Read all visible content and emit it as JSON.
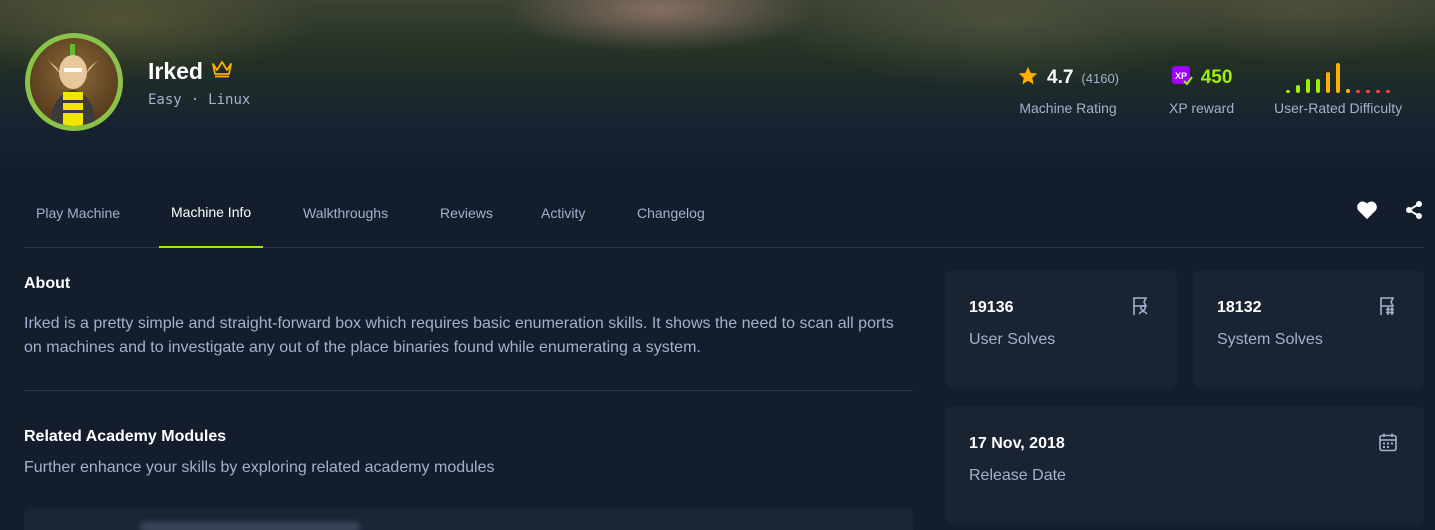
{
  "machine": {
    "name": "Irked",
    "difficulty": "Easy",
    "separator": "·",
    "os": "Linux",
    "avatar_icon": "mohawk-character-avatar",
    "tier_icon": "crown-icon"
  },
  "stats": {
    "rating": {
      "value": "4.7",
      "count": "(4160)",
      "label": "Machine Rating",
      "icon": "star-icon"
    },
    "xp": {
      "value": "450",
      "label": "XP reward",
      "icon": "xp-badge-icon"
    },
    "difficulty": {
      "label": "User-Rated Difficulty",
      "distribution": [
        0.1,
        0.25,
        0.45,
        0.45,
        0.7,
        1.0,
        0.12,
        0.08,
        0.05,
        0.05,
        0.05
      ]
    }
  },
  "tabs": [
    {
      "label": "Play Machine",
      "active": false
    },
    {
      "label": "Machine Info",
      "active": true
    },
    {
      "label": "Walkthroughs",
      "active": false
    },
    {
      "label": "Reviews",
      "active": false
    },
    {
      "label": "Activity",
      "active": false
    },
    {
      "label": "Changelog",
      "active": false
    }
  ],
  "actions": {
    "favorite_icon": "heart-icon",
    "share_icon": "share-icon"
  },
  "about": {
    "title": "About",
    "text": "Irked is a pretty simple and straight-forward box which requires basic enumeration skills. It shows the need to scan all ports on machines and to investigate any out of the place binaries found while enumerating a system."
  },
  "modules": {
    "title": "Related Academy Modules",
    "text": "Further enhance your skills by exploring related academy modules"
  },
  "cards": {
    "user_solves": {
      "value": "19136",
      "label": "User Solves",
      "icon": "user-flag-icon"
    },
    "system_solves": {
      "value": "18132",
      "label": "System Solves",
      "icon": "root-flag-icon"
    },
    "release": {
      "value": "17 Nov, 2018",
      "label": "Release Date",
      "icon": "calendar-icon"
    }
  },
  "colors": {
    "accent": "#9fef00",
    "background": "#141d2b",
    "card": "#1a2332",
    "star": "#ffaf00",
    "xp_badge": "#9f00ff",
    "difficulty_easy": "#9fef00",
    "difficulty_mid": "#ffaf00",
    "difficulty_hard": "#ff3e3e"
  }
}
